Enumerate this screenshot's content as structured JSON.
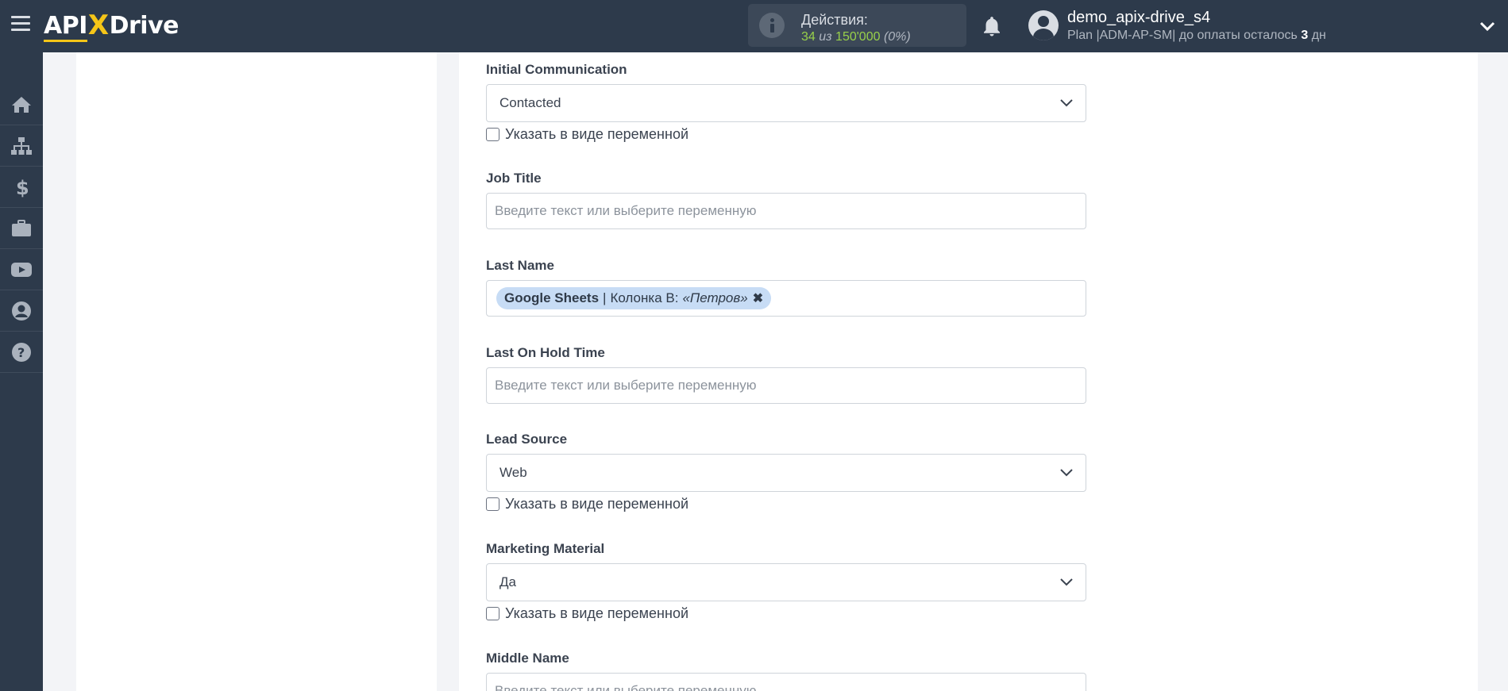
{
  "header": {
    "logo_left": "API",
    "logo_x": "X",
    "logo_right": "Drive",
    "actions_title": "Действия:",
    "actions_used": "34",
    "actions_of": "из",
    "actions_total": "150'000",
    "actions_pct": "(0%)",
    "username": "demo_apix-drive_s4",
    "plan_prefix": "Plan |ADM-AP-SM| до оплаты осталось",
    "plan_days": "3",
    "plan_suffix": "дн"
  },
  "sidebar": {
    "items": [
      {
        "icon": "home-icon"
      },
      {
        "icon": "sitemap-icon"
      },
      {
        "icon": "dollar-icon"
      },
      {
        "icon": "briefcase-icon"
      },
      {
        "icon": "youtube-icon"
      },
      {
        "icon": "user-icon"
      },
      {
        "icon": "help-icon"
      }
    ]
  },
  "form": {
    "checkbox_label": "Указать в виде переменной",
    "placeholder": "Введите текст или выберите переменную",
    "fields": {
      "initial_communication": {
        "label": "Initial Communication",
        "value": "Contacted"
      },
      "job_title": {
        "label": "Job Title"
      },
      "last_name": {
        "label": "Last Name",
        "tag_source": "Google Sheets",
        "tag_column": "Колонка B:",
        "tag_sample": "«Петров»",
        "tag_remove": "✖"
      },
      "last_on_hold_time": {
        "label": "Last On Hold Time"
      },
      "lead_source": {
        "label": "Lead Source",
        "value": "Web"
      },
      "marketing_material": {
        "label": "Marketing Material",
        "value": "Да"
      },
      "middle_name": {
        "label": "Middle Name"
      }
    }
  },
  "colors": {
    "topbar": "#2d3a4b",
    "accent_yellow": "#f5c518",
    "actions_green": "#98d04a",
    "tag_blue": "#c7dcf5"
  }
}
